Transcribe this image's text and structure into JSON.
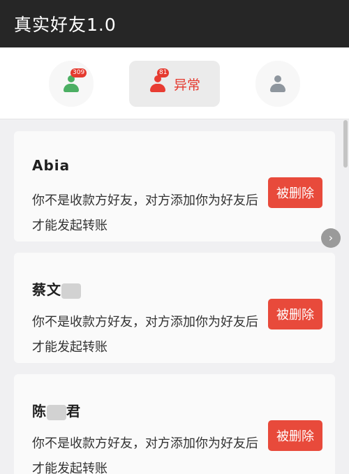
{
  "app": {
    "title": "真实好友1.0"
  },
  "tabs": {
    "normal": {
      "badge": "309",
      "icon": "person-green-icon",
      "color": "#4caf63"
    },
    "abnormal": {
      "badge": "81",
      "label": "异常",
      "icon": "person-red-icon",
      "color": "#e83c32"
    },
    "other": {
      "icon": "person-grey-icon",
      "color": "#8e969e"
    }
  },
  "cards": [
    {
      "name": "Abia",
      "message": "你不是收款方好友，对方添加你为好友后才能发起转账",
      "button": "被删除"
    },
    {
      "name_prefix": "蔡文",
      "name_suffix": "",
      "message": "你不是收款方好友，对方添加你为好友后才能发起转账",
      "button": "被删除"
    },
    {
      "name_prefix": "陈",
      "name_suffix": "君",
      "message": "你不是收款方好友，对方添加你为好友后才能发起转账",
      "button": "被删除"
    }
  ],
  "colors": {
    "accent": "#e53a2f",
    "header": "#262626"
  }
}
